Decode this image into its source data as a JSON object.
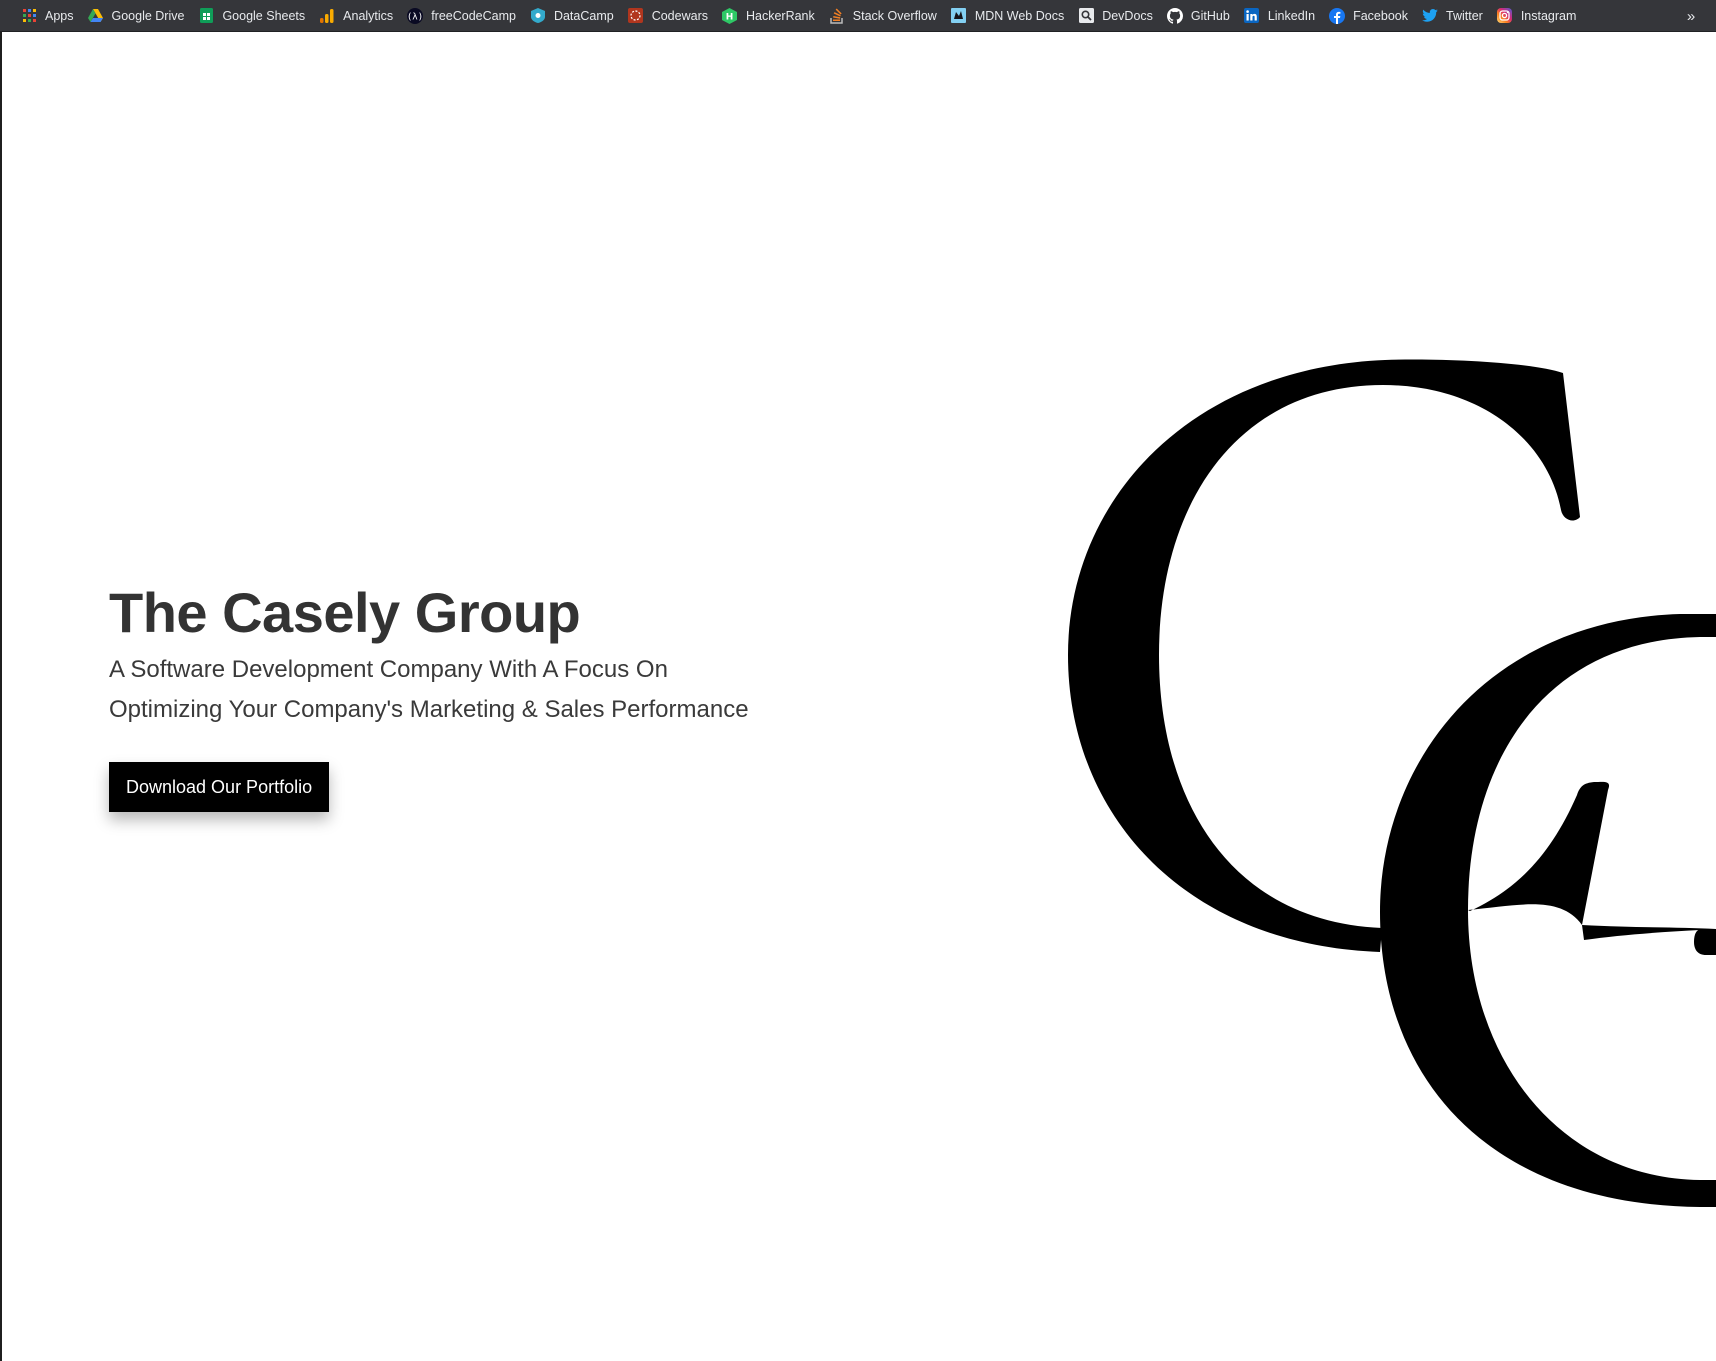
{
  "bookmarks": [
    {
      "label": "Apps",
      "icon": "apps-grid-icon"
    },
    {
      "label": "Google Drive",
      "icon": "google-drive-icon"
    },
    {
      "label": "Google Sheets",
      "icon": "google-sheets-icon"
    },
    {
      "label": "Analytics",
      "icon": "analytics-icon"
    },
    {
      "label": "freeCodeCamp",
      "icon": "freecodecamp-icon"
    },
    {
      "label": "DataCamp",
      "icon": "datacamp-icon"
    },
    {
      "label": "Codewars",
      "icon": "codewars-icon"
    },
    {
      "label": "HackerRank",
      "icon": "hackerrank-icon"
    },
    {
      "label": "Stack Overflow",
      "icon": "stackoverflow-icon"
    },
    {
      "label": "MDN Web Docs",
      "icon": "mdn-icon"
    },
    {
      "label": "DevDocs",
      "icon": "devdocs-icon"
    },
    {
      "label": "GitHub",
      "icon": "github-icon"
    },
    {
      "label": "LinkedIn",
      "icon": "linkedin-icon"
    },
    {
      "label": "Facebook",
      "icon": "facebook-icon"
    },
    {
      "label": "Twitter",
      "icon": "twitter-icon"
    },
    {
      "label": "Instagram",
      "icon": "instagram-icon"
    }
  ],
  "overflow": {
    "label": "»",
    "icon": "chevron-double-right-icon"
  },
  "hero": {
    "title": "The Casely Group",
    "subtitle_line1": "A Software Development Company With A Focus On",
    "subtitle_line2": "Optimizing Your Company's Marketing & Sales Performance",
    "cta_label": "Download Our Portfolio"
  },
  "colors": {
    "bookmarks_bar_bg": "#35363a",
    "bookmarks_text": "#e8eaed",
    "title": "#333333",
    "subtitle": "#3a3a3a",
    "cta_bg": "#000000",
    "cta_text": "#ffffff",
    "monogram": "#000000"
  }
}
